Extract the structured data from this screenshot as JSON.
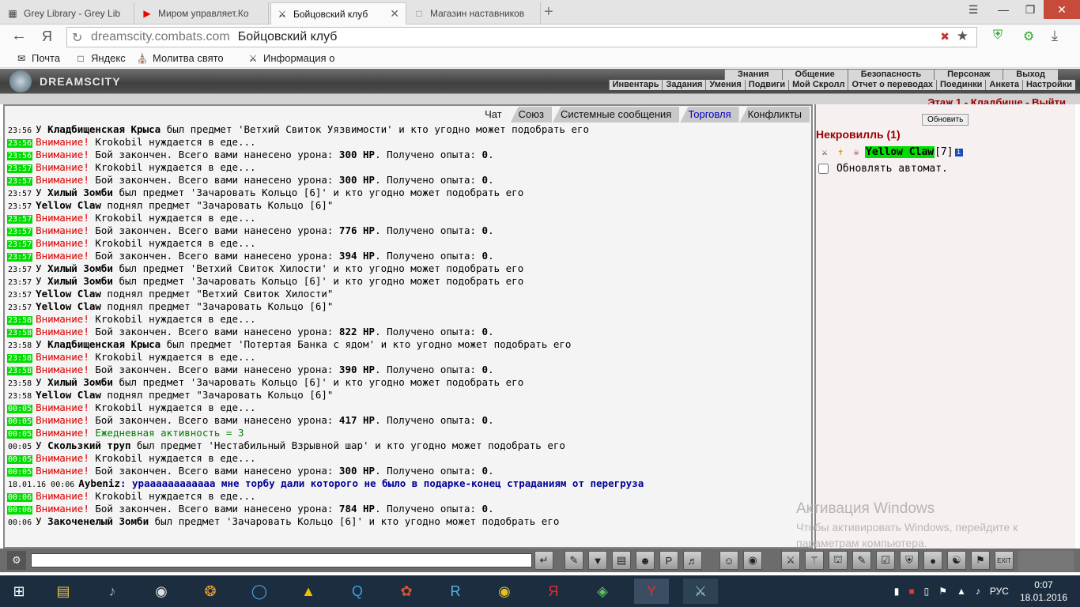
{
  "browser": {
    "tabs": [
      {
        "title": "Grey Library - Grey Lib",
        "icon": "library-icon"
      },
      {
        "title": "Миром управляет.Ко",
        "icon": "youtube-icon"
      },
      {
        "title": "Бойцовский клуб",
        "icon": "crossed-swords-icon",
        "active": true
      },
      {
        "title": "Магазин наставников",
        "icon": "page-icon"
      }
    ],
    "address": {
      "host": "dreamscity.combats.com",
      "title": "Бойцовский клуб",
      "back_label": "Я"
    },
    "bookmarks": [
      {
        "label": "Почта",
        "icon": "mail-icon"
      },
      {
        "label": "Яндекс",
        "icon": "page-icon"
      },
      {
        "label": "Молитва свято",
        "icon": "church-icon"
      },
      {
        "label": "Информация о",
        "icon": "crossed-swords-icon"
      }
    ]
  },
  "game": {
    "logo": "DREAMSCITY",
    "menu_top": [
      "Знания",
      "Общение",
      "Безопасность",
      "Персонаж",
      "Выход"
    ],
    "menu_bottom": [
      "Инвентарь",
      "Задания",
      "Умения",
      "Подвиги",
      "Мой Скролл",
      "Отчет о переводах",
      "Поединки",
      "Анкета",
      "Настройки"
    ],
    "location": "Этаж 1 - Кладбище - Выйти"
  },
  "chat": {
    "tabs": [
      "Чат",
      "Союз",
      "Системные сообщения",
      "Торговля",
      "Конфликты"
    ],
    "messages": [
      {
        "time": "23:56",
        "hl": false,
        "kind": "drop",
        "prefix": "У ",
        "name": "Кладбищенская Крыса",
        "text": " был предмет 'Ветхий Свиток Уязвимости' и кто угодно может подобрать его"
      },
      {
        "time": "23:56",
        "hl": true,
        "kind": "att",
        "att": "Внимание!",
        "text": " Krokobil нуждается в еде..."
      },
      {
        "time": "23:56",
        "hl": true,
        "kind": "dmg",
        "att": "Внимание!",
        "text": " Бой закончен. Всего вами нанесено урона: ",
        "dmg": "300 HP",
        "rest": ". Получено опыта: ",
        "xp": "0",
        "end": "."
      },
      {
        "time": "23:57",
        "hl": true,
        "kind": "att",
        "att": "Внимание!",
        "text": " Krokobil нуждается в еде..."
      },
      {
        "time": "23:57",
        "hl": true,
        "kind": "dmg",
        "att": "Внимание!",
        "text": " Бой закончен. Всего вами нанесено урона: ",
        "dmg": "300 HP",
        "rest": ". Получено опыта: ",
        "xp": "0",
        "end": "."
      },
      {
        "time": "23:57",
        "hl": false,
        "kind": "drop",
        "prefix": "У ",
        "name": "Хилый Зомби",
        "text": " был предмет 'Зачаровать Кольцо [6]' и кто угодно может подобрать его"
      },
      {
        "time": "23:57",
        "hl": false,
        "kind": "pick",
        "name": "Yellow Claw",
        "text": " поднял предмет \"Зачаровать Кольцо [6]\""
      },
      {
        "time": "23:57",
        "hl": true,
        "kind": "att",
        "att": "Внимание!",
        "text": " Krokobil нуждается в еде..."
      },
      {
        "time": "23:57",
        "hl": true,
        "kind": "dmg",
        "att": "Внимание!",
        "text": " Бой закончен. Всего вами нанесено урона: ",
        "dmg": "776 HP",
        "rest": ". Получено опыта: ",
        "xp": "0",
        "end": "."
      },
      {
        "time": "23:57",
        "hl": true,
        "kind": "att",
        "att": "Внимание!",
        "text": " Krokobil нуждается в еде..."
      },
      {
        "time": "23:57",
        "hl": true,
        "kind": "dmg",
        "att": "Внимание!",
        "text": " Бой закончен. Всего вами нанесено урона: ",
        "dmg": "394 HP",
        "rest": ". Получено опыта: ",
        "xp": "0",
        "end": "."
      },
      {
        "time": "23:57",
        "hl": false,
        "kind": "drop",
        "prefix": "У ",
        "name": "Хилый Зомби",
        "text": " был предмет 'Ветхий Свиток Хилости' и кто угодно может подобрать его"
      },
      {
        "time": "23:57",
        "hl": false,
        "kind": "drop",
        "prefix": "У ",
        "name": "Хилый Зомби",
        "text": " был предмет 'Зачаровать Кольцо [6]' и кто угодно может подобрать его"
      },
      {
        "time": "23:57",
        "hl": false,
        "kind": "pick",
        "name": "Yellow Claw",
        "text": " поднял предмет \"Ветхий Свиток Хилости\""
      },
      {
        "time": "23:57",
        "hl": false,
        "kind": "pick",
        "name": "Yellow Claw",
        "text": " поднял предмет \"Зачаровать Кольцо [6]\""
      },
      {
        "time": "23:58",
        "hl": true,
        "kind": "att",
        "att": "Внимание!",
        "text": " Krokobil нуждается в еде..."
      },
      {
        "time": "23:58",
        "hl": true,
        "kind": "dmg",
        "att": "Внимание!",
        "text": " Бой закончен. Всего вами нанесено урона: ",
        "dmg": "822 HP",
        "rest": ". Получено опыта: ",
        "xp": "0",
        "end": "."
      },
      {
        "time": "23:58",
        "hl": false,
        "kind": "drop",
        "prefix": "У ",
        "name": "Кладбищенская Крыса",
        "text": " был предмет 'Потертая Банка с ядом' и кто угодно может подобрать его"
      },
      {
        "time": "23:58",
        "hl": true,
        "kind": "att",
        "att": "Внимание!",
        "text": " Krokobil нуждается в еде..."
      },
      {
        "time": "23:58",
        "hl": true,
        "kind": "dmg",
        "att": "Внимание!",
        "text": " Бой закончен. Всего вами нанесено урона: ",
        "dmg": "390 HP",
        "rest": ". Получено опыта: ",
        "xp": "0",
        "end": "."
      },
      {
        "time": "23:58",
        "hl": false,
        "kind": "drop",
        "prefix": "У ",
        "name": "Хилый Зомби",
        "text": " был предмет 'Зачаровать Кольцо [6]' и кто угодно может подобрать его"
      },
      {
        "time": "23:58",
        "hl": false,
        "kind": "pick",
        "name": "Yellow Claw",
        "text": " поднял предмет \"Зачаровать Кольцо [6]\""
      },
      {
        "time": "00:05",
        "hl": true,
        "kind": "att",
        "att": "Внимание!",
        "text": " Krokobil нуждается в еде..."
      },
      {
        "time": "00:05",
        "hl": true,
        "kind": "dmg",
        "att": "Внимание!",
        "text": " Бой закончен. Всего вами нанесено урона: ",
        "dmg": "417 HP",
        "rest": ". Получено опыта: ",
        "xp": "0",
        "end": "."
      },
      {
        "time": "00:05",
        "hl": true,
        "kind": "daily",
        "att": "Внимание!",
        "text": " Ежедневная активность = 3"
      },
      {
        "time": "00:05",
        "hl": false,
        "kind": "drop",
        "prefix": "У ",
        "name": "Скользкий труп",
        "text": " был предмет 'Нестабильный Взрывной шар' и кто угодно может подобрать его"
      },
      {
        "time": "00:05",
        "hl": true,
        "kind": "att",
        "att": "Внимание!",
        "text": " Krokobil нуждается в еде..."
      },
      {
        "time": "00:05",
        "hl": true,
        "kind": "dmg",
        "att": "Внимание!",
        "text": " Бой закончен. Всего вами нанесено урона: ",
        "dmg": "300 HP",
        "rest": ". Получено опыта: ",
        "xp": "0",
        "end": "."
      },
      {
        "time": "18.01.16 00:06",
        "hl": false,
        "kind": "priv",
        "name": "Aybeniz",
        "text": ": ураааааааааааа мне торбу дали которого не было в подарке-конец страданиям от перегруза"
      },
      {
        "time": "00:06",
        "hl": true,
        "kind": "att",
        "att": "Внимание!",
        "text": " Krokobil нуждается в еде..."
      },
      {
        "time": "00:06",
        "hl": true,
        "kind": "dmg",
        "att": "Внимание!",
        "text": " Бой закончен. Всего вами нанесено урона: ",
        "dmg": "784 HP",
        "rest": ". Получено опыта: ",
        "xp": "0",
        "end": "."
      },
      {
        "time": "00:06",
        "hl": false,
        "kind": "drop",
        "prefix": "У ",
        "name": "Закоченелый Зомби",
        "text": " был предмет 'Зачаровать Кольцо [6]' и кто угодно может подобрать его"
      }
    ]
  },
  "room": {
    "refresh_label": "Обновить",
    "title": "Некровилль (1)",
    "user": {
      "name": "Yellow Claw",
      "level": "[7]",
      "info": "i"
    },
    "auto_label": "Обновлять автомат."
  },
  "watermark": {
    "line1": "Активация Windows",
    "line2": "Чтобы активировать Windows, перейдите к параметрам компьютера."
  },
  "toolbar": {
    "exit_label": "EXIT"
  },
  "taskbar": {
    "lang": "РУС",
    "time": "0:07",
    "date": "18.01.2016"
  }
}
